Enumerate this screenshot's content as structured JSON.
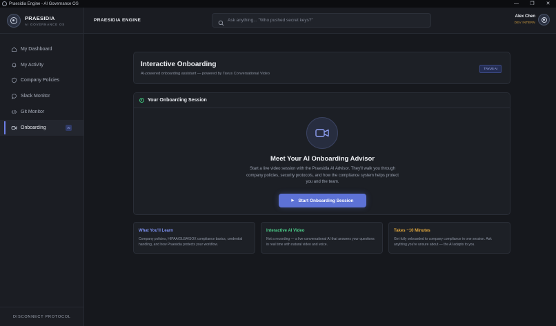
{
  "window": {
    "title": "Praesidia Engine - AI Governance OS",
    "controls": [
      "—",
      "❐",
      "✕"
    ]
  },
  "brand": {
    "name": "PRAESIDIA",
    "subtitle": "AI GOVERNANCE OS"
  },
  "sidebar": {
    "items": [
      {
        "label": "My Dashboard",
        "icon": "home-icon",
        "active": false
      },
      {
        "label": "My Activity",
        "icon": "bell-icon",
        "active": false
      },
      {
        "label": "Company Policies",
        "icon": "shield-icon",
        "active": false
      },
      {
        "label": "Slack Monitor",
        "icon": "chat-icon",
        "active": false
      },
      {
        "label": "Git Monitor",
        "icon": "code-icon",
        "active": false
      },
      {
        "label": "Onboarding",
        "icon": "video-icon",
        "active": true,
        "badge": "AI"
      }
    ],
    "footer": "DISCONNECT PROTOCOL"
  },
  "header": {
    "title": "PRAESIDIA ENGINE",
    "search_placeholder": "Ask anything... \"Who pushed secret keys?\"",
    "user_name": "Alex Chen",
    "user_role": "DEV INTERN"
  },
  "hero": {
    "title": "Interactive Onboarding",
    "subtitle": "AI-powered onboarding assistant — powered by Tavus Conversational Video",
    "badge": "TAVUS AI"
  },
  "session": {
    "header": "Your Onboarding Session",
    "title": "Meet Your AI Onboarding Advisor",
    "description": "Start a live video session with the Praesidia AI Advisor. They'll walk you through company policies, security protocols, and how the compliance system helps protect you and the team.",
    "button": "Start Onboarding Session"
  },
  "cards": [
    {
      "title": "What You'll Learn",
      "color": "#7f93f5",
      "body": "Company policies, HIPAA/GLBA/SOX compliance basics, credential handling, and how Praesidia protects your workflow."
    },
    {
      "title": "Interactive AI Video",
      "color": "#4ccf8a",
      "body": "Not a recording — a live conversational AI that answers your questions in real time with natural video and voice."
    },
    {
      "title": "Takes ~10 Minutes",
      "color": "#e0a63c",
      "body": "Get fully onboarded to company compliance in one session. Ask anything you're unsure about — the AI adapts to you."
    }
  ],
  "colors": {
    "accent": "#5d72d6",
    "success": "#3fbf7a",
    "warning": "#d9a441"
  }
}
